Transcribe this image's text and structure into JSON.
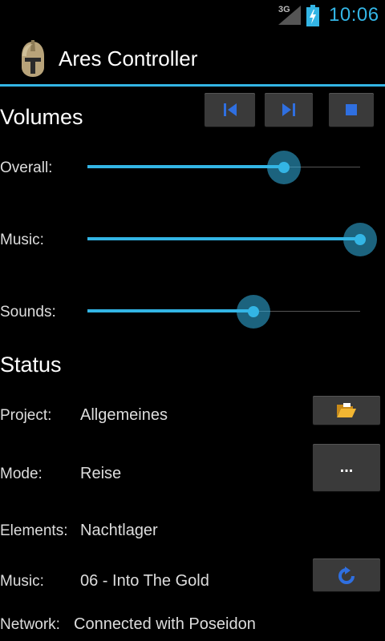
{
  "status_bar": {
    "network_label": "3G",
    "clock": "10:06",
    "icons": [
      "signal-icon",
      "battery-charging-icon"
    ]
  },
  "action_bar": {
    "title": "Ares Controller",
    "icon": "helmet-icon"
  },
  "volumes": {
    "title": "Volumes",
    "transport": [
      {
        "name": "previous-button",
        "icon": "skip-previous-icon"
      },
      {
        "name": "next-button",
        "icon": "skip-next-icon"
      },
      {
        "name": "stop-button",
        "icon": "stop-icon"
      }
    ],
    "sliders": [
      {
        "label": "Overall:",
        "level": 0.72
      },
      {
        "label": "Music:",
        "level": 1.0
      },
      {
        "label": "Sounds:",
        "level": 0.61
      }
    ]
  },
  "status": {
    "title": "Status",
    "project_label": "Project:",
    "project_value": "Allgemeines",
    "mode_label": "Mode:",
    "mode_value": "Reise",
    "mode_button": "...",
    "elements_label": "Elements:",
    "elements_value": "Nachtlager",
    "music_label": "Music:",
    "music_value": "06 - Into The Gold",
    "network_label": "Network:",
    "network_value": "Connected with Poseidon"
  },
  "colors": {
    "accent": "#33b5e5",
    "background": "#000000",
    "button": "#3a3a3a"
  }
}
